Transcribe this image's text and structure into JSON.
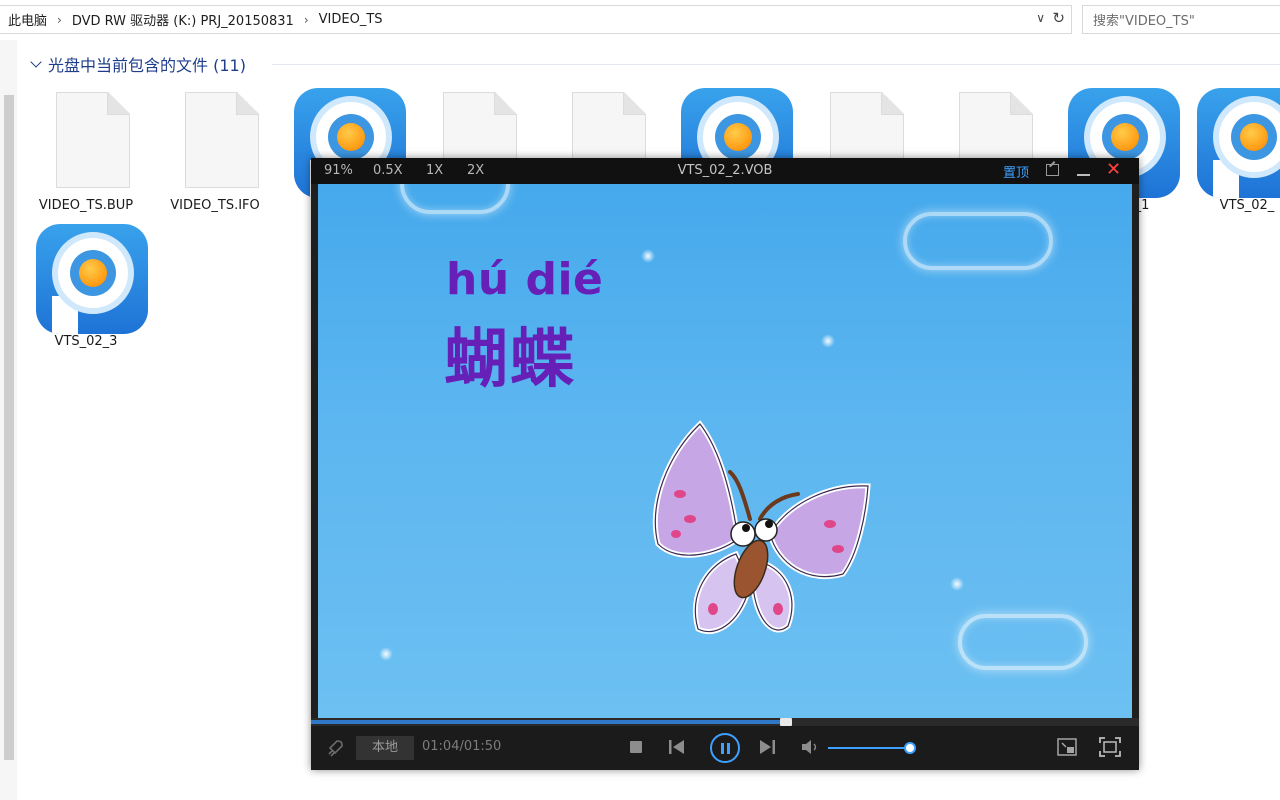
{
  "address_bar": {
    "crumbs": [
      "此电脑",
      "DVD RW 驱动器 (K:) PRJ_20150831",
      "VIDEO_TS"
    ],
    "search_placeholder": "搜索\"VIDEO_TS\""
  },
  "group": {
    "title": "光盘中当前包含的文件 (11)"
  },
  "files": [
    {
      "name": "VIDEO_TS.BUP",
      "kind": "document"
    },
    {
      "name": "VIDEO_TS.IFO",
      "kind": "document"
    },
    {
      "name": "",
      "kind": "pptv-video"
    },
    {
      "name": "",
      "kind": "document"
    },
    {
      "name": "",
      "kind": "document"
    },
    {
      "name": "",
      "kind": "pptv-video"
    },
    {
      "name": "",
      "kind": "document"
    },
    {
      "name": "",
      "kind": "document"
    },
    {
      "name": "VTS_02_1",
      "kind": "pptv-video"
    },
    {
      "name": "VTS_02_",
      "kind": "pptv-video"
    },
    {
      "name": "VTS_02_3",
      "kind": "pptv-video"
    }
  ],
  "player": {
    "zoom_options": [
      "91%",
      "0.5X",
      "1X",
      "2X"
    ],
    "title": "VTS_02_2.VOB",
    "pin_label": "置顶",
    "video": {
      "pinyin": "hú dié",
      "hanzi": "蝴蝶"
    },
    "local_label": "本地",
    "time": "01:04/01:50",
    "progress": 0.574,
    "volume": 1.0,
    "accent_color": "#3ea1ff",
    "close_color": "#ff4040"
  }
}
